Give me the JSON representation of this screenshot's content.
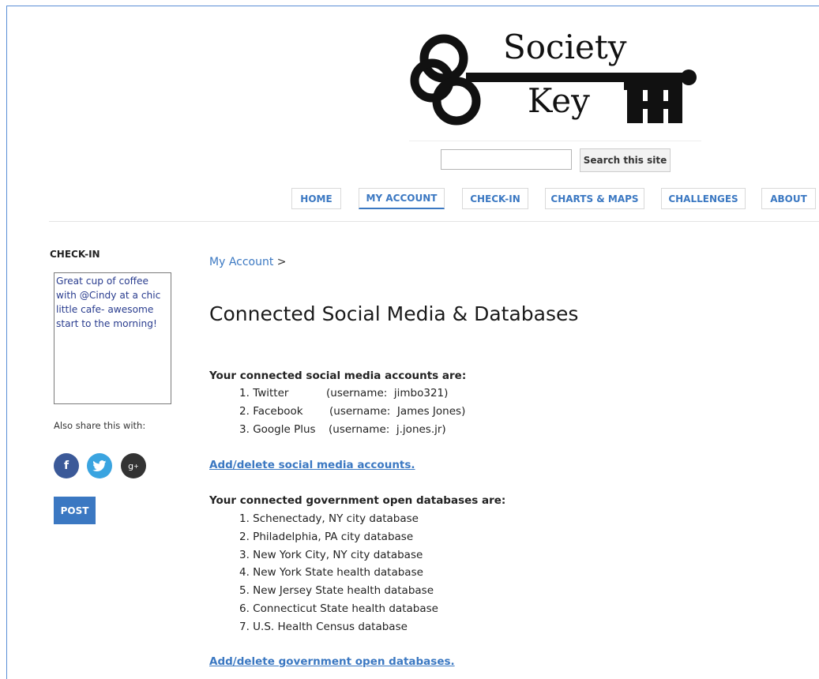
{
  "brand": {
    "logo_text_top": "Society",
    "logo_text_bottom": "Key",
    "logo_icon": "key-icon"
  },
  "search": {
    "value": "",
    "placeholder": "",
    "button_label": "Search this site"
  },
  "nav": {
    "items": [
      {
        "label": "HOME",
        "active": false
      },
      {
        "label": "MY ACCOUNT",
        "active": true
      },
      {
        "label": "CHECK-IN",
        "active": false
      },
      {
        "label": "CHARTS & MAPS",
        "active": false
      },
      {
        "label": "CHALLENGES",
        "active": false
      },
      {
        "label": "ABOUT",
        "active": false
      }
    ]
  },
  "sidebar": {
    "title": "CHECK-IN",
    "checkin_text": "Great cup of coffee with @Cindy at a chic little cafe- awesome start to the morning!",
    "share_label": "Also share this with:",
    "share_icons": [
      "facebook-icon",
      "twitter-icon",
      "google-plus-icon"
    ],
    "post_label": "POST"
  },
  "breadcrumb": {
    "link": "My Account",
    "separator": ">"
  },
  "page": {
    "title": "Connected Social Media & Databases"
  },
  "social_accounts": {
    "heading": "Your connected social media accounts are:",
    "items": [
      {
        "number": "1.",
        "name": "Twitter",
        "username": "(username:  jimbo321)"
      },
      {
        "number": "2.",
        "name": "Facebook",
        "username": "(username:  James Jones)"
      },
      {
        "number": "3.",
        "name": "Google Plus",
        "username": "(username:  j.jones.jr)"
      }
    ],
    "action_link": "Add/delete social media accounts."
  },
  "databases": {
    "heading": "Your connected government open databases are:",
    "items": [
      "1. Schenectady, NY city database",
      "2. Philadelphia, PA city database",
      "3. New York City, NY city database",
      "4. New York State health database",
      "5. New Jersey State health database",
      "6. Connecticut State health database",
      "7. U.S. Health Census database"
    ],
    "action_link": "Add/delete government open databases."
  },
  "colors": {
    "link": "#3b78c2",
    "facebook": "#3b5998",
    "twitter": "#3aa4e0",
    "google_plus": "#333333"
  }
}
